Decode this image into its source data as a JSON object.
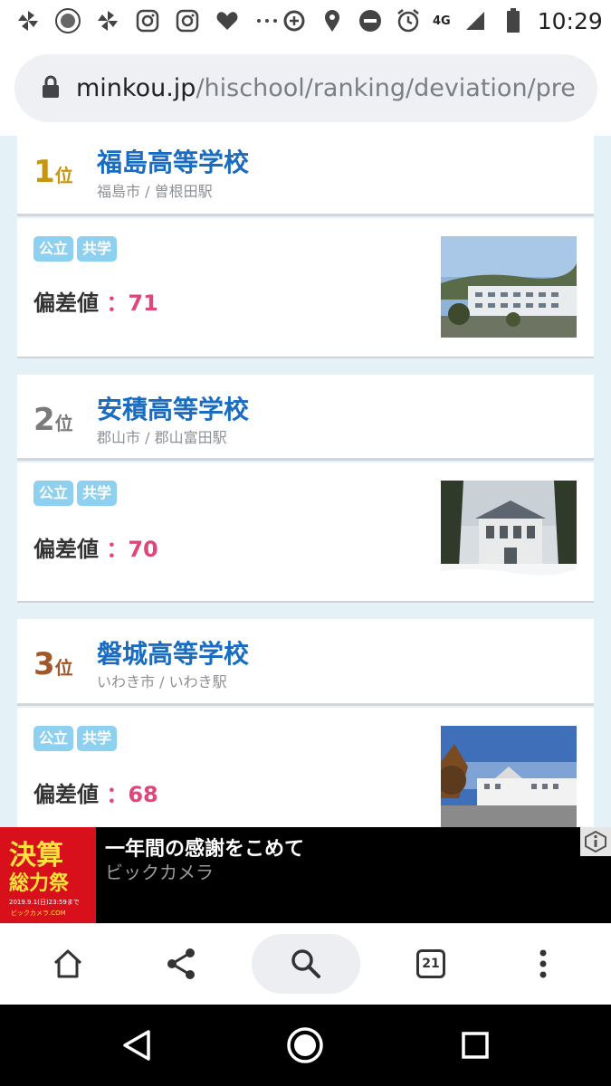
{
  "status_bar": {
    "time": "10:29",
    "network": "4G",
    "icons": [
      "pinwheel-icon",
      "badge-icon",
      "pinwheel-icon",
      "instagram-icon",
      "instagram-icon",
      "heart-icon",
      "more-dots-icon",
      "data-saver-icon",
      "location-icon",
      "do-not-disturb-icon",
      "alarm-icon",
      "signal-icon",
      "battery-icon"
    ]
  },
  "url_bar": {
    "host": "minkou.jp",
    "path": "/hischool/ranking/deviation/pre"
  },
  "rankings": [
    {
      "rank": "1",
      "rank_unit": "位",
      "rank_color": "#c8960c",
      "name": "福島高等学校",
      "location": "福島市 / 曽根田駅",
      "tags": [
        "公立",
        "共学"
      ],
      "deviation_label": "偏差値",
      "deviation_sep": "：",
      "deviation": "71"
    },
    {
      "rank": "2",
      "rank_unit": "位",
      "rank_color": "#7a7a7a",
      "name": "安積高等学校",
      "location": "郡山市 / 郡山富田駅",
      "tags": [
        "公立",
        "共学"
      ],
      "deviation_label": "偏差値",
      "deviation_sep": "：",
      "deviation": "70"
    },
    {
      "rank": "3",
      "rank_unit": "位",
      "rank_color": "#a0582a",
      "name": "磐城高等学校",
      "location": "いわき市 / いわき駅",
      "tags": [
        "公立",
        "共学"
      ],
      "deviation_label": "偏差値",
      "deviation_sep": "：",
      "deviation": "68"
    }
  ],
  "ad": {
    "logo_line1": "決算",
    "logo_line2": "総力祭",
    "logo_line3": "2019.9.1(日)23:59まで",
    "logo_line4": "ビックカメラ.COM",
    "title": "一年間の感謝をこめて",
    "advertiser": "ビックカメラ"
  },
  "toolbar": {
    "tab_count": "21"
  },
  "colors": {
    "link": "#1a6cc0",
    "tag_bg": "#8ed0f0",
    "deviation": "#e0457b",
    "page_bg": "#e4f2f8"
  }
}
